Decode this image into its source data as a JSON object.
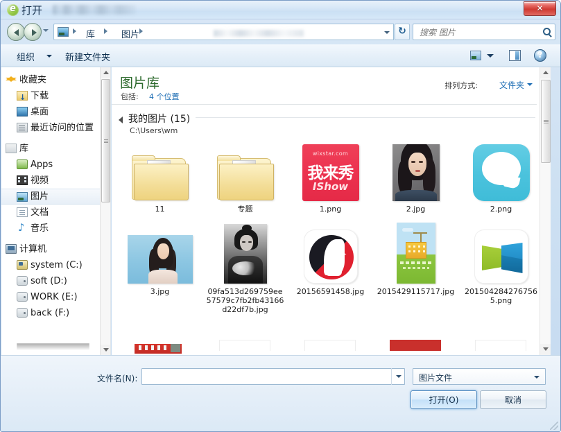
{
  "window": {
    "title": "打开",
    "title_icon": "ie-green-icon",
    "close_label": "✕"
  },
  "nav": {
    "back_icon": "back-arrow-icon",
    "forward_icon": "forward-arrow-icon",
    "history_icon": "chevron-down-icon",
    "address_icon": "pictures-library-icon",
    "breadcrumbs": [
      "库",
      "图片"
    ],
    "dropdown_icon": "chevron-down-icon",
    "refresh_icon": "refresh-icon",
    "search_placeholder": "搜索 图片",
    "search_value": "",
    "search_icon": "search-icon"
  },
  "toolbar": {
    "organize_label": "组织",
    "organize_arrow_icon": "chevron-down-icon",
    "new_folder_label": "新建文件夹",
    "view_icon": "view-mode-icon",
    "view_arrow_icon": "chevron-down-icon",
    "preview_pane_icon": "preview-pane-icon",
    "help_icon": "help-icon"
  },
  "sidebar": {
    "groups": [
      {
        "header": {
          "label": "收藏夹",
          "icon": "star-icon"
        },
        "items": [
          {
            "label": "下载",
            "icon": "downloads-folder-icon"
          },
          {
            "label": "桌面",
            "icon": "desktop-icon"
          },
          {
            "label": "最近访问的位置",
            "icon": "recent-places-icon"
          }
        ]
      },
      {
        "header": {
          "label": "库",
          "icon": "library-icon"
        },
        "items": [
          {
            "label": "Apps",
            "icon": "apps-folder-icon"
          },
          {
            "label": "视频",
            "icon": "videos-icon"
          },
          {
            "label": "图片",
            "icon": "pictures-icon",
            "selected": true
          },
          {
            "label": "文档",
            "icon": "documents-icon"
          },
          {
            "label": "音乐",
            "icon": "music-icon"
          }
        ]
      },
      {
        "header": {
          "label": "计算机",
          "icon": "computer-icon"
        },
        "items": [
          {
            "label": "system (C:)",
            "icon": "system-drive-icon"
          },
          {
            "label": "soft (D:)",
            "icon": "drive-icon"
          },
          {
            "label": "WORK (E:)",
            "icon": "drive-icon"
          },
          {
            "label": "back (F:)",
            "icon": "drive-icon"
          }
        ]
      }
    ],
    "scroll_up_icon": "scroll-up-icon",
    "scroll_down_icon": "scroll-down-icon"
  },
  "main": {
    "library_title": "图片库",
    "includes_label": "包括:",
    "includes_link": "4 个位置",
    "arrange_label": "排列方式:",
    "arrange_value": "文件夹",
    "arrange_arrow_icon": "chevron-down-icon",
    "group": {
      "collapse_icon": "collapse-triangle-icon",
      "title": "我的图片 (15)",
      "path": "C:\\Users\\wm"
    },
    "files": [
      {
        "name": "11",
        "kind": "folder",
        "thumb": "folder-icon"
      },
      {
        "name": "专题",
        "kind": "folder",
        "thumb": "folder-icon"
      },
      {
        "name": "1.png",
        "kind": "image",
        "thumb": "wixstar-logo",
        "art": {
          "line1": "wixstar.com",
          "line2": "我来秀",
          "line3": "IShow"
        }
      },
      {
        "name": "2.jpg",
        "kind": "image",
        "thumb": "woman-portrait-grey"
      },
      {
        "name": "2.png",
        "kind": "image",
        "thumb": "cyan-q-bubble-icon"
      },
      {
        "name": "3.jpg",
        "kind": "image",
        "thumb": "woman-portrait-blue"
      },
      {
        "name": "09fa513d269759ee57579c7fb2fb43166d22df7b.jpg",
        "kind": "image",
        "thumb": "woman-portrait-bw"
      },
      {
        "name": "20156591458.jpg",
        "kind": "image",
        "thumb": "red-black-face-logo"
      },
      {
        "name": "2015429115717.jpg",
        "kind": "image",
        "thumb": "green-poster"
      },
      {
        "name": "2015042842767565.png",
        "kind": "image",
        "thumb": "green-blue-book-logo"
      }
    ],
    "scroll_up_icon": "scroll-up-icon",
    "scroll_down_icon": "scroll-down-icon"
  },
  "footer": {
    "filename_label": "文件名(N):",
    "filename_value": "",
    "filename_placeholder": "",
    "filename_dropdown_icon": "chevron-down-icon",
    "filter_value": "图片文件",
    "filter_arrow_icon": "chevron-down-icon",
    "open_button": "打开(O)",
    "cancel_button": "取消",
    "resize_grip_icon": "resize-grip-icon"
  },
  "colors": {
    "titlebar": "#d7e7f7",
    "close_red": "#cf3a32",
    "library_green": "#2d6a2d",
    "link_blue": "#1f6fb5",
    "accent_button": "#c3e0f8"
  }
}
